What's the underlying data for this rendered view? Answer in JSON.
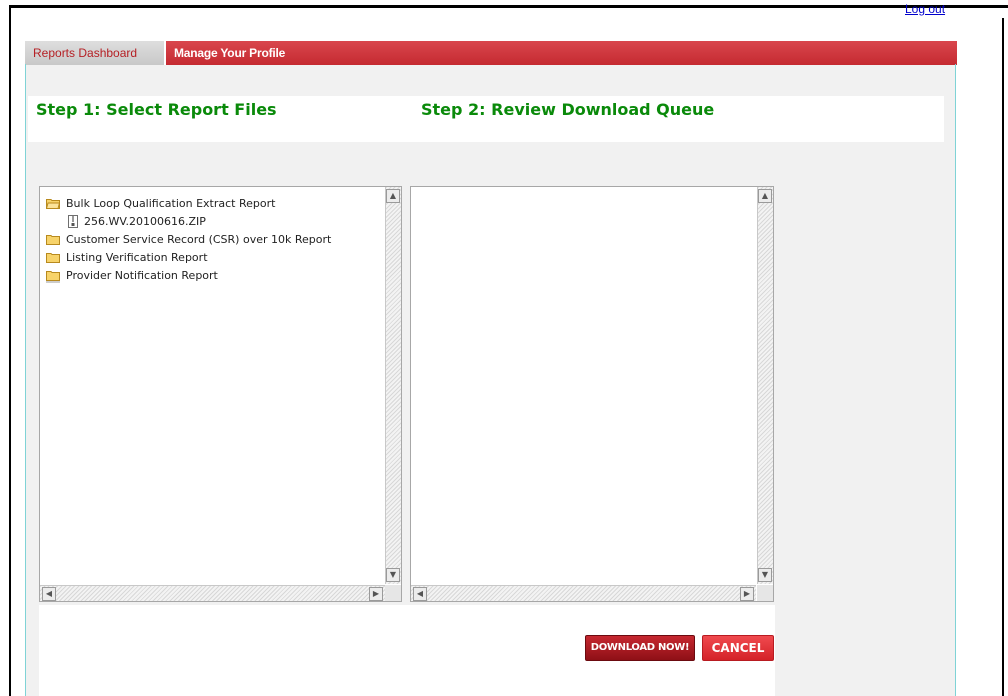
{
  "header": {
    "logout_label": "Log out"
  },
  "tabs": [
    {
      "label": "Reports Dashboard",
      "active": true
    },
    {
      "label": "Manage Your Profile",
      "active": false
    }
  ],
  "steps": {
    "step1_title": "Step 1: Select Report Files",
    "step2_title": "Step 2: Review Download Queue"
  },
  "report_tree": {
    "items": [
      {
        "label": "Bulk Loop Qualification Extract Report",
        "type": "folder",
        "expanded": true
      },
      {
        "label": "256.WV.20100616.ZIP",
        "type": "file"
      },
      {
        "label": "Customer Service Record (CSR) over 10k Report",
        "type": "folder"
      },
      {
        "label": "Listing Verification Report",
        "type": "folder"
      },
      {
        "label": "Provider Notification Report",
        "type": "folder"
      }
    ]
  },
  "download_queue": {
    "items": []
  },
  "actions": {
    "download_label": "DOWNLOAD NOW!",
    "cancel_label": "CANCEL"
  },
  "icons": {
    "folder": "folder-icon",
    "file": "zip-file-icon",
    "scroll_up": "arrow-up-icon",
    "scroll_down": "arrow-down-icon",
    "scroll_left": "arrow-left-icon",
    "scroll_right": "arrow-right-icon"
  },
  "colors": {
    "tab_bar": "#c52a31",
    "step_title": "#0a8a0a",
    "download_button": "#a3161d",
    "cancel_button": "#e2333a",
    "link": "#0000cc"
  }
}
